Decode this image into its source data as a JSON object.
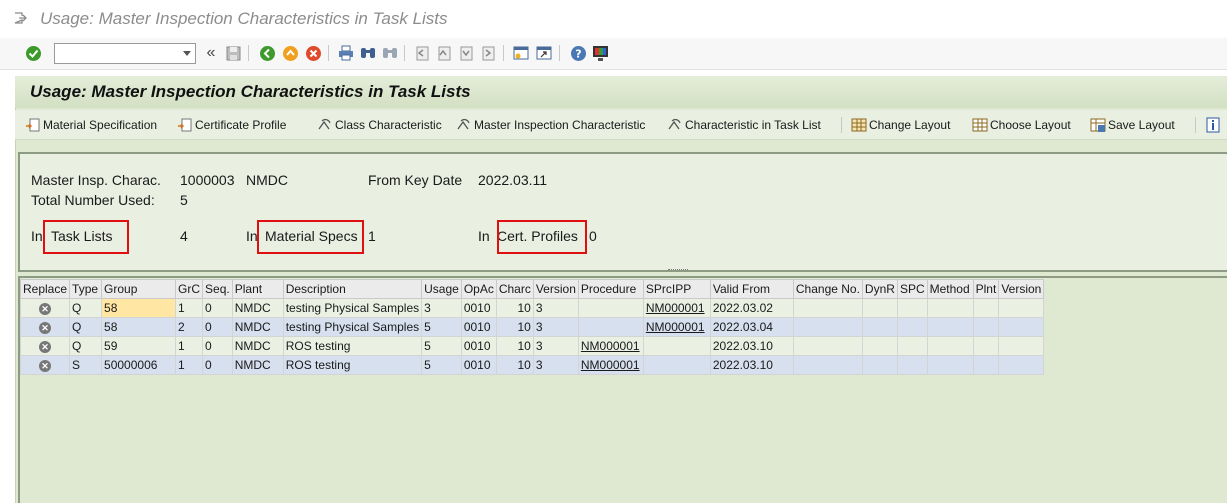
{
  "window": {
    "title": "Usage: Master Inspection Characteristics in Task Lists"
  },
  "std_toolbar": {
    "command_field_value": "",
    "icons": [
      "enter-icon",
      "back-nav-icon",
      "save-icon",
      "back-icon",
      "exit-icon",
      "cancel-icon",
      "print-icon",
      "find-icon",
      "find-next-icon",
      "first-page-icon",
      "previous-page-icon",
      "next-page-icon",
      "last-page-icon",
      "create-session-icon",
      "shortcut-icon",
      "help-icon",
      "layout-icon"
    ]
  },
  "app": {
    "title": "Usage: Master Inspection Characteristics in Task Lists",
    "buttons": [
      "Material Specification",
      "Certificate Profile",
      "Class Characteristic",
      "Master Inspection Characteristic",
      "Characteristic in Task List",
      "Change Layout",
      "Choose Layout",
      "Save Layout"
    ]
  },
  "header": {
    "mic_label": "Master Insp. Charac.",
    "mic_value": "1000003",
    "plant_value": "NMDC",
    "keydate_label": "From Key Date",
    "keydate_value": "2022.03.11",
    "total_label": "Total Number Used:",
    "total_value": "5",
    "in_prefix": "In",
    "tasklists_label": "Task Lists",
    "tasklists_value": "4",
    "matspecs_label": "Material Specs",
    "matspecs_value": "1",
    "certprof_label": "Cert. Profiles",
    "certprof_value": "0"
  },
  "table": {
    "columns": [
      "Replace",
      "Type",
      "Group",
      "GrC",
      "Seq.",
      "Plant",
      "Description",
      "Usage",
      "OpAc",
      "Charc",
      "Version",
      "Procedure",
      "SPrcIPP",
      "Valid From",
      "Change No.",
      "DynR",
      "SPC",
      "Method",
      "Plnt",
      "Version"
    ],
    "rows": [
      [
        "",
        "Q",
        "58",
        "1",
        "0",
        "NMDC",
        "testing Physical Samples",
        "3",
        "0010",
        "10",
        "3",
        "",
        "NM000001",
        "2022.03.02",
        "",
        "",
        "",
        "",
        "",
        ""
      ],
      [
        "",
        "Q",
        "58",
        "2",
        "0",
        "NMDC",
        "testing Physical Samples",
        "5",
        "0010",
        "10",
        "3",
        "",
        "NM000001",
        "2022.03.04",
        "",
        "",
        "",
        "",
        "",
        ""
      ],
      [
        "",
        "Q",
        "59",
        "1",
        "0",
        "NMDC",
        "ROS testing",
        "5",
        "0010",
        "10",
        "3",
        "NM000001",
        "",
        "2022.03.10",
        "",
        "",
        "",
        "",
        "",
        ""
      ],
      [
        "",
        "S",
        "50000006",
        "1",
        "0",
        "NMDC",
        "ROS testing",
        "5",
        "0010",
        "10",
        "3",
        "NM000001",
        "",
        "2022.03.10",
        "",
        "",
        "",
        "",
        "",
        ""
      ]
    ]
  }
}
